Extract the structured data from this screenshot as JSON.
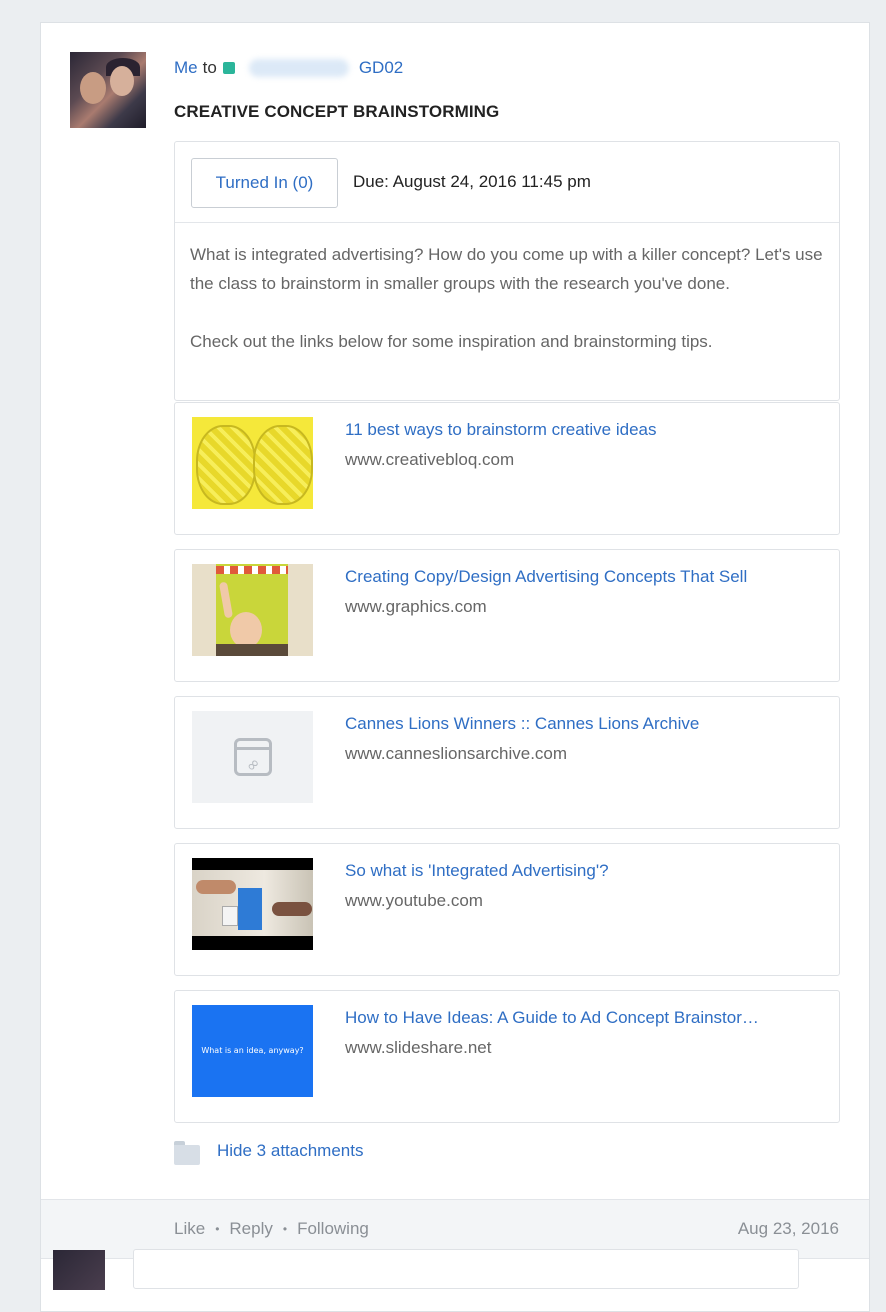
{
  "post": {
    "sender": "Me",
    "to_word": "to",
    "group_name": "GD02",
    "group_color": "#2bb59a",
    "title": "CREATIVE CONCEPT BRAINSTORMING"
  },
  "assignment": {
    "turned_in_label": "Turned In (0)",
    "due_text": "Due: August 24, 2016 11:45 pm",
    "description": [
      "What is integrated advertising? How do you come up with a killer concept? Let's use the class to brainstorm in smaller groups with the research you've done.",
      "Check out the links below for some inspiration and brainstorming tips."
    ]
  },
  "attachments": [
    {
      "title": "11 best ways to brainstorm creative ideas",
      "url": "www.creativebloq.com",
      "thumb": "brain-image"
    },
    {
      "title": "Creating Copy/Design Advertising Concepts That Sell",
      "url": "www.graphics.com",
      "thumb": "classroom-image"
    },
    {
      "title": "Cannes Lions Winners :: Cannes Lions Archive",
      "url": "www.canneslionsarchive.com",
      "thumb": "link-icon"
    },
    {
      "title": "So what is 'Integrated Advertising'?",
      "url": "www.youtube.com",
      "thumb": "video-image"
    },
    {
      "title": "How to Have Ideas: A Guide to Ad Concept Brainstor…",
      "url": "www.slideshare.net",
      "thumb": "slide-image",
      "thumb_text": "What is an idea, anyway?"
    }
  ],
  "hide_attachments_label": "Hide 3 attachments",
  "footer": {
    "like": "Like",
    "reply": "Reply",
    "following": "Following",
    "separator": "•",
    "date": "Aug 23, 2016"
  },
  "colors": {
    "link": "#2f6ec4",
    "background": "#ebeef1",
    "slide_blue": "#1a73f2"
  }
}
